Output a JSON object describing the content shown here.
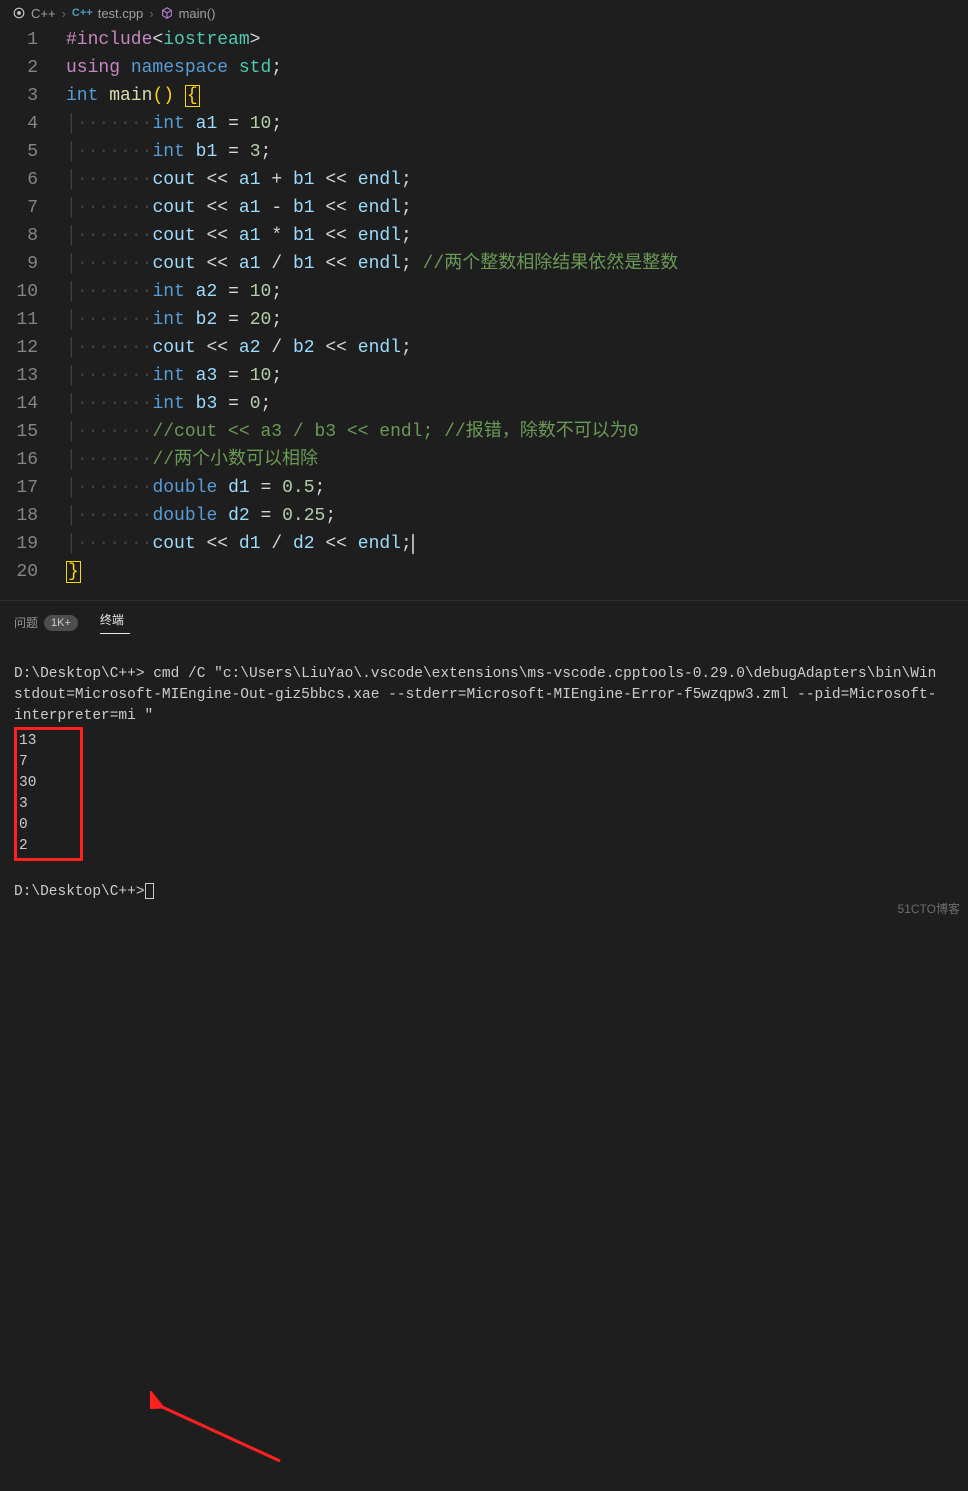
{
  "breadcrumb": {
    "root": "C++",
    "file": "test.cpp",
    "symbol": "main()"
  },
  "code": {
    "lines": [
      {
        "n": "1",
        "seg": [
          [
            "pp",
            "#include"
          ],
          [
            "op",
            "<"
          ],
          [
            "ty",
            "iostream"
          ],
          [
            "op",
            ">"
          ]
        ]
      },
      {
        "n": "2",
        "seg": [
          [
            "pp",
            "using"
          ],
          [
            "op",
            " "
          ],
          [
            "kw",
            "namespace"
          ],
          [
            "op",
            " "
          ],
          [
            "ty",
            "std"
          ],
          [
            "pn",
            ";"
          ]
        ]
      },
      {
        "n": "3",
        "seg": [
          [
            "kw",
            "int"
          ],
          [
            "op",
            " "
          ],
          [
            "fn",
            "main"
          ],
          [
            "br0",
            "("
          ],
          [
            "br0",
            ")"
          ],
          [
            "op",
            " "
          ],
          [
            "cursor-open",
            "{"
          ]
        ]
      },
      {
        "n": "4",
        "ind": 2,
        "seg": [
          [
            "kw",
            "int"
          ],
          [
            "op",
            " "
          ],
          [
            "va",
            "a1"
          ],
          [
            "op",
            " "
          ],
          [
            "pn",
            "="
          ],
          [
            "op",
            " "
          ],
          [
            "num",
            "10"
          ],
          [
            "pn",
            ";"
          ]
        ]
      },
      {
        "n": "5",
        "ind": 2,
        "seg": [
          [
            "kw",
            "int"
          ],
          [
            "op",
            " "
          ],
          [
            "va",
            "b1"
          ],
          [
            "op",
            " "
          ],
          [
            "pn",
            "="
          ],
          [
            "op",
            " "
          ],
          [
            "num",
            "3"
          ],
          [
            "pn",
            ";"
          ]
        ]
      },
      {
        "n": "6",
        "ind": 2,
        "seg": [
          [
            "va",
            "cout"
          ],
          [
            "op",
            " "
          ],
          [
            "pn",
            "<<"
          ],
          [
            "op",
            " "
          ],
          [
            "va",
            "a1"
          ],
          [
            "op",
            " "
          ],
          [
            "pn",
            "+"
          ],
          [
            "op",
            " "
          ],
          [
            "va",
            "b1"
          ],
          [
            "op",
            " "
          ],
          [
            "pn",
            "<<"
          ],
          [
            "op",
            " "
          ],
          [
            "va",
            "endl"
          ],
          [
            "pn",
            ";"
          ]
        ]
      },
      {
        "n": "7",
        "ind": 2,
        "seg": [
          [
            "va",
            "cout"
          ],
          [
            "op",
            " "
          ],
          [
            "pn",
            "<<"
          ],
          [
            "op",
            " "
          ],
          [
            "va",
            "a1"
          ],
          [
            "op",
            " "
          ],
          [
            "pn",
            "-"
          ],
          [
            "op",
            " "
          ],
          [
            "va",
            "b1"
          ],
          [
            "op",
            " "
          ],
          [
            "pn",
            "<<"
          ],
          [
            "op",
            " "
          ],
          [
            "va",
            "endl"
          ],
          [
            "pn",
            ";"
          ]
        ]
      },
      {
        "n": "8",
        "ind": 2,
        "seg": [
          [
            "va",
            "cout"
          ],
          [
            "op",
            " "
          ],
          [
            "pn",
            "<<"
          ],
          [
            "op",
            " "
          ],
          [
            "va",
            "a1"
          ],
          [
            "op",
            " "
          ],
          [
            "pn",
            "*"
          ],
          [
            "op",
            " "
          ],
          [
            "va",
            "b1"
          ],
          [
            "op",
            " "
          ],
          [
            "pn",
            "<<"
          ],
          [
            "op",
            " "
          ],
          [
            "va",
            "endl"
          ],
          [
            "pn",
            ";"
          ]
        ]
      },
      {
        "n": "9",
        "ind": 2,
        "seg": [
          [
            "va",
            "cout"
          ],
          [
            "op",
            " "
          ],
          [
            "pn",
            "<<"
          ],
          [
            "op",
            " "
          ],
          [
            "va",
            "a1"
          ],
          [
            "op",
            " "
          ],
          [
            "pn",
            "/"
          ],
          [
            "op",
            " "
          ],
          [
            "va",
            "b1"
          ],
          [
            "op",
            " "
          ],
          [
            "pn",
            "<<"
          ],
          [
            "op",
            " "
          ],
          [
            "va",
            "endl"
          ],
          [
            "pn",
            ";"
          ],
          [
            "op",
            " "
          ],
          [
            "cm",
            "//两个整数相除结果依然是整数"
          ]
        ]
      },
      {
        "n": "10",
        "ind": 2,
        "seg": [
          [
            "kw",
            "int"
          ],
          [
            "op",
            " "
          ],
          [
            "va",
            "a2"
          ],
          [
            "op",
            " "
          ],
          [
            "pn",
            "="
          ],
          [
            "op",
            " "
          ],
          [
            "num",
            "10"
          ],
          [
            "pn",
            ";"
          ]
        ]
      },
      {
        "n": "11",
        "ind": 2,
        "seg": [
          [
            "kw",
            "int"
          ],
          [
            "op",
            " "
          ],
          [
            "va",
            "b2"
          ],
          [
            "op",
            " "
          ],
          [
            "pn",
            "="
          ],
          [
            "op",
            " "
          ],
          [
            "num",
            "20"
          ],
          [
            "pn",
            ";"
          ]
        ]
      },
      {
        "n": "12",
        "ind": 2,
        "seg": [
          [
            "va",
            "cout"
          ],
          [
            "op",
            " "
          ],
          [
            "pn",
            "<<"
          ],
          [
            "op",
            " "
          ],
          [
            "va",
            "a2"
          ],
          [
            "op",
            " "
          ],
          [
            "pn",
            "/"
          ],
          [
            "op",
            " "
          ],
          [
            "va",
            "b2"
          ],
          [
            "op",
            " "
          ],
          [
            "pn",
            "<<"
          ],
          [
            "op",
            " "
          ],
          [
            "va",
            "endl"
          ],
          [
            "pn",
            ";"
          ]
        ]
      },
      {
        "n": "13",
        "ind": 2,
        "seg": [
          [
            "kw",
            "int"
          ],
          [
            "op",
            " "
          ],
          [
            "va",
            "a3"
          ],
          [
            "op",
            " "
          ],
          [
            "pn",
            "="
          ],
          [
            "op",
            " "
          ],
          [
            "num",
            "10"
          ],
          [
            "pn",
            ";"
          ]
        ]
      },
      {
        "n": "14",
        "ind": 2,
        "seg": [
          [
            "kw",
            "int"
          ],
          [
            "op",
            " "
          ],
          [
            "va",
            "b3"
          ],
          [
            "op",
            " "
          ],
          [
            "pn",
            "="
          ],
          [
            "op",
            " "
          ],
          [
            "num",
            "0"
          ],
          [
            "pn",
            ";"
          ]
        ]
      },
      {
        "n": "15",
        "ind": 2,
        "seg": [
          [
            "cm",
            "//cout << a3 / b3 << endl; //报错，除数不可以为0"
          ]
        ]
      },
      {
        "n": "16",
        "ind": 2,
        "seg": [
          [
            "cm",
            "//两个小数可以相除"
          ]
        ]
      },
      {
        "n": "17",
        "ind": 2,
        "seg": [
          [
            "kw",
            "double"
          ],
          [
            "op",
            " "
          ],
          [
            "va",
            "d1"
          ],
          [
            "op",
            " "
          ],
          [
            "pn",
            "="
          ],
          [
            "op",
            " "
          ],
          [
            "num",
            "0.5"
          ],
          [
            "pn",
            ";"
          ]
        ]
      },
      {
        "n": "18",
        "ind": 2,
        "seg": [
          [
            "kw",
            "double"
          ],
          [
            "op",
            " "
          ],
          [
            "va",
            "d2"
          ],
          [
            "op",
            " "
          ],
          [
            "pn",
            "="
          ],
          [
            "op",
            " "
          ],
          [
            "num",
            "0.25"
          ],
          [
            "pn",
            ";"
          ]
        ]
      },
      {
        "n": "19",
        "ind": 2,
        "seg": [
          [
            "va",
            "cout"
          ],
          [
            "op",
            " "
          ],
          [
            "pn",
            "<<"
          ],
          [
            "op",
            " "
          ],
          [
            "va",
            "d1"
          ],
          [
            "op",
            " "
          ],
          [
            "pn",
            "/"
          ],
          [
            "op",
            " "
          ],
          [
            "va",
            "d2"
          ],
          [
            "op",
            " "
          ],
          [
            "pn",
            "<<"
          ],
          [
            "op",
            " "
          ],
          [
            "va",
            "endl"
          ],
          [
            "pn",
            ";"
          ],
          [
            "txtcur",
            ""
          ]
        ]
      },
      {
        "n": "20",
        "ind": 0,
        "seg": [
          [
            "cursor-close",
            "}"
          ]
        ]
      }
    ]
  },
  "panel": {
    "tabs": {
      "problems": "问题",
      "problems_badge": "1K+",
      "terminal": "终端"
    },
    "prompt1": "D:\\Desktop\\C++>",
    "cmd": " cmd /C \"c:\\Users\\LiuYao\\.vscode\\extensions\\ms-vscode.cpptools-0.29.0\\debugAdapters\\bin\\Win",
    "cmd2": "stdout=Microsoft-MIEngine-Out-giz5bbcs.xae --stderr=Microsoft-MIEngine-Error-f5wzqpw3.zml --pid=Microsoft-",
    "cmd3": "interpreter=mi \"",
    "output": [
      "13",
      "7",
      "30",
      "3",
      "0",
      "2"
    ],
    "prompt2": "D:\\Desktop\\C++>"
  },
  "watermark": "51CTO博客"
}
